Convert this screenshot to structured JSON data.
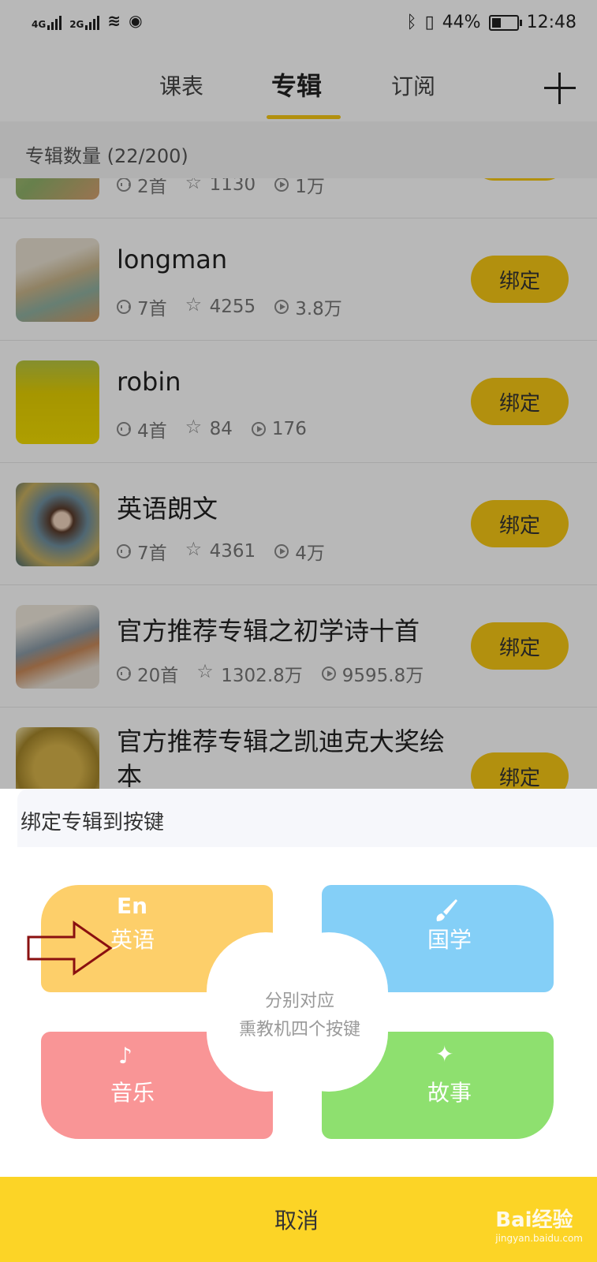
{
  "status_bar": {
    "network1": "4G",
    "network2": "2G",
    "battery": "44%",
    "time": "12:48",
    "battery_level": 0.44
  },
  "tabs": [
    {
      "label": "课表"
    },
    {
      "label": "专辑"
    },
    {
      "label": "订阅"
    }
  ],
  "album_count": "专辑数量 (22/200)",
  "albums": [
    {
      "title": "",
      "tracks": "2首",
      "favorites": "1130",
      "plays": "1万",
      "button": "绑定"
    },
    {
      "title": "longman",
      "tracks": "7首",
      "favorites": "4255",
      "plays": "3.8万",
      "button": "绑定"
    },
    {
      "title": "robin",
      "tracks": "4首",
      "favorites": "84",
      "plays": "176",
      "button": "绑定"
    },
    {
      "title": "英语朗文",
      "tracks": "7首",
      "favorites": "4361",
      "plays": "4万",
      "button": "绑定"
    },
    {
      "title": "官方推荐专辑之初学诗十首",
      "tracks": "20首",
      "favorites": "1302.8万",
      "plays": "9595.8万",
      "button": "绑定"
    },
    {
      "title": "官方推荐专辑之凯迪克大奖绘本",
      "tracks": "",
      "favorites": "",
      "plays": "",
      "button": "绑定"
    }
  ],
  "sheet": {
    "title": "绑定专辑到按键",
    "keys": {
      "english": {
        "icon_text": "En",
        "label": "英语"
      },
      "guoxue": {
        "label": "国学"
      },
      "music": {
        "label": "音乐"
      },
      "story": {
        "label": "故事"
      }
    },
    "center_line1": "分别对应",
    "center_line2": "熏教机四个按键",
    "cancel": "取消"
  },
  "watermark": {
    "text": "Bai经验",
    "sub": "jingyan.baidu.com"
  },
  "colors": {
    "accent": "#f7c814",
    "english": "#fdcf6a",
    "guoxue": "#84cff7",
    "music": "#f99596",
    "story": "#8ee06f",
    "cancel_bar": "#fcd426"
  }
}
